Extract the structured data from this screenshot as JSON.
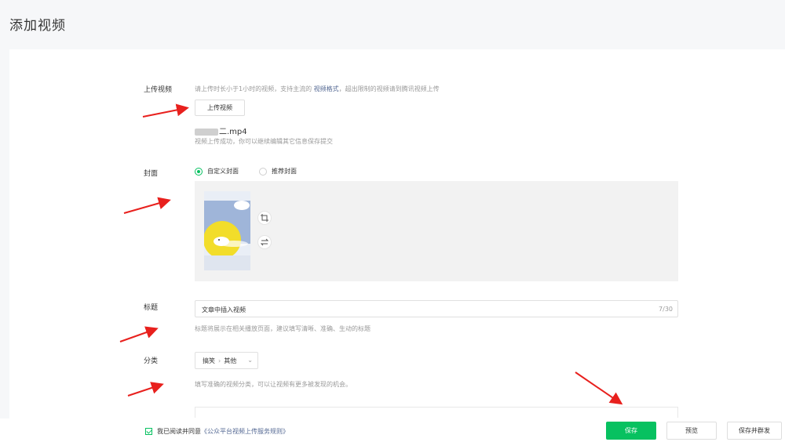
{
  "page": {
    "title": "添加视频"
  },
  "upload": {
    "label": "上传视频",
    "hint_prefix": "请上传时长小于1小时的视频，支持主流的 ",
    "hint_link": "视频格式",
    "hint_suffix": "，超出限制的视频请到腾讯视频上传",
    "button": "上传视频",
    "filename_visible": "二.mp4",
    "success_msg": "视频上传成功，你可以继续编辑其它信息保存提交"
  },
  "cover": {
    "label": "封面",
    "options": [
      {
        "label": "自定义封面",
        "selected": true
      },
      {
        "label": "推荐封面",
        "selected": false
      }
    ],
    "tools": [
      {
        "icon": "crop-icon",
        "glyph": "⌗"
      },
      {
        "icon": "swap-icon",
        "glyph": "⇆"
      }
    ]
  },
  "title_field": {
    "label": "标题",
    "value": "文章中插入视频",
    "count": "7/30",
    "hint": "标题将展示在相关播放页面，建议填写清晰、准确、生动的标题"
  },
  "category": {
    "label": "分类",
    "primary": "搞笑",
    "secondary": "其他",
    "hint": "填写准确的视频分类，可以让视频有更多被发现的机会。"
  },
  "footer": {
    "agree_text": "我已阅读并同意",
    "agree_link": "《公众平台视频上传服务规则》",
    "save": "保存",
    "preview": "预览",
    "save_send": "保存并群发"
  },
  "colors": {
    "accent": "#07c160",
    "link": "#576b95",
    "arrow": "#e8201d"
  }
}
